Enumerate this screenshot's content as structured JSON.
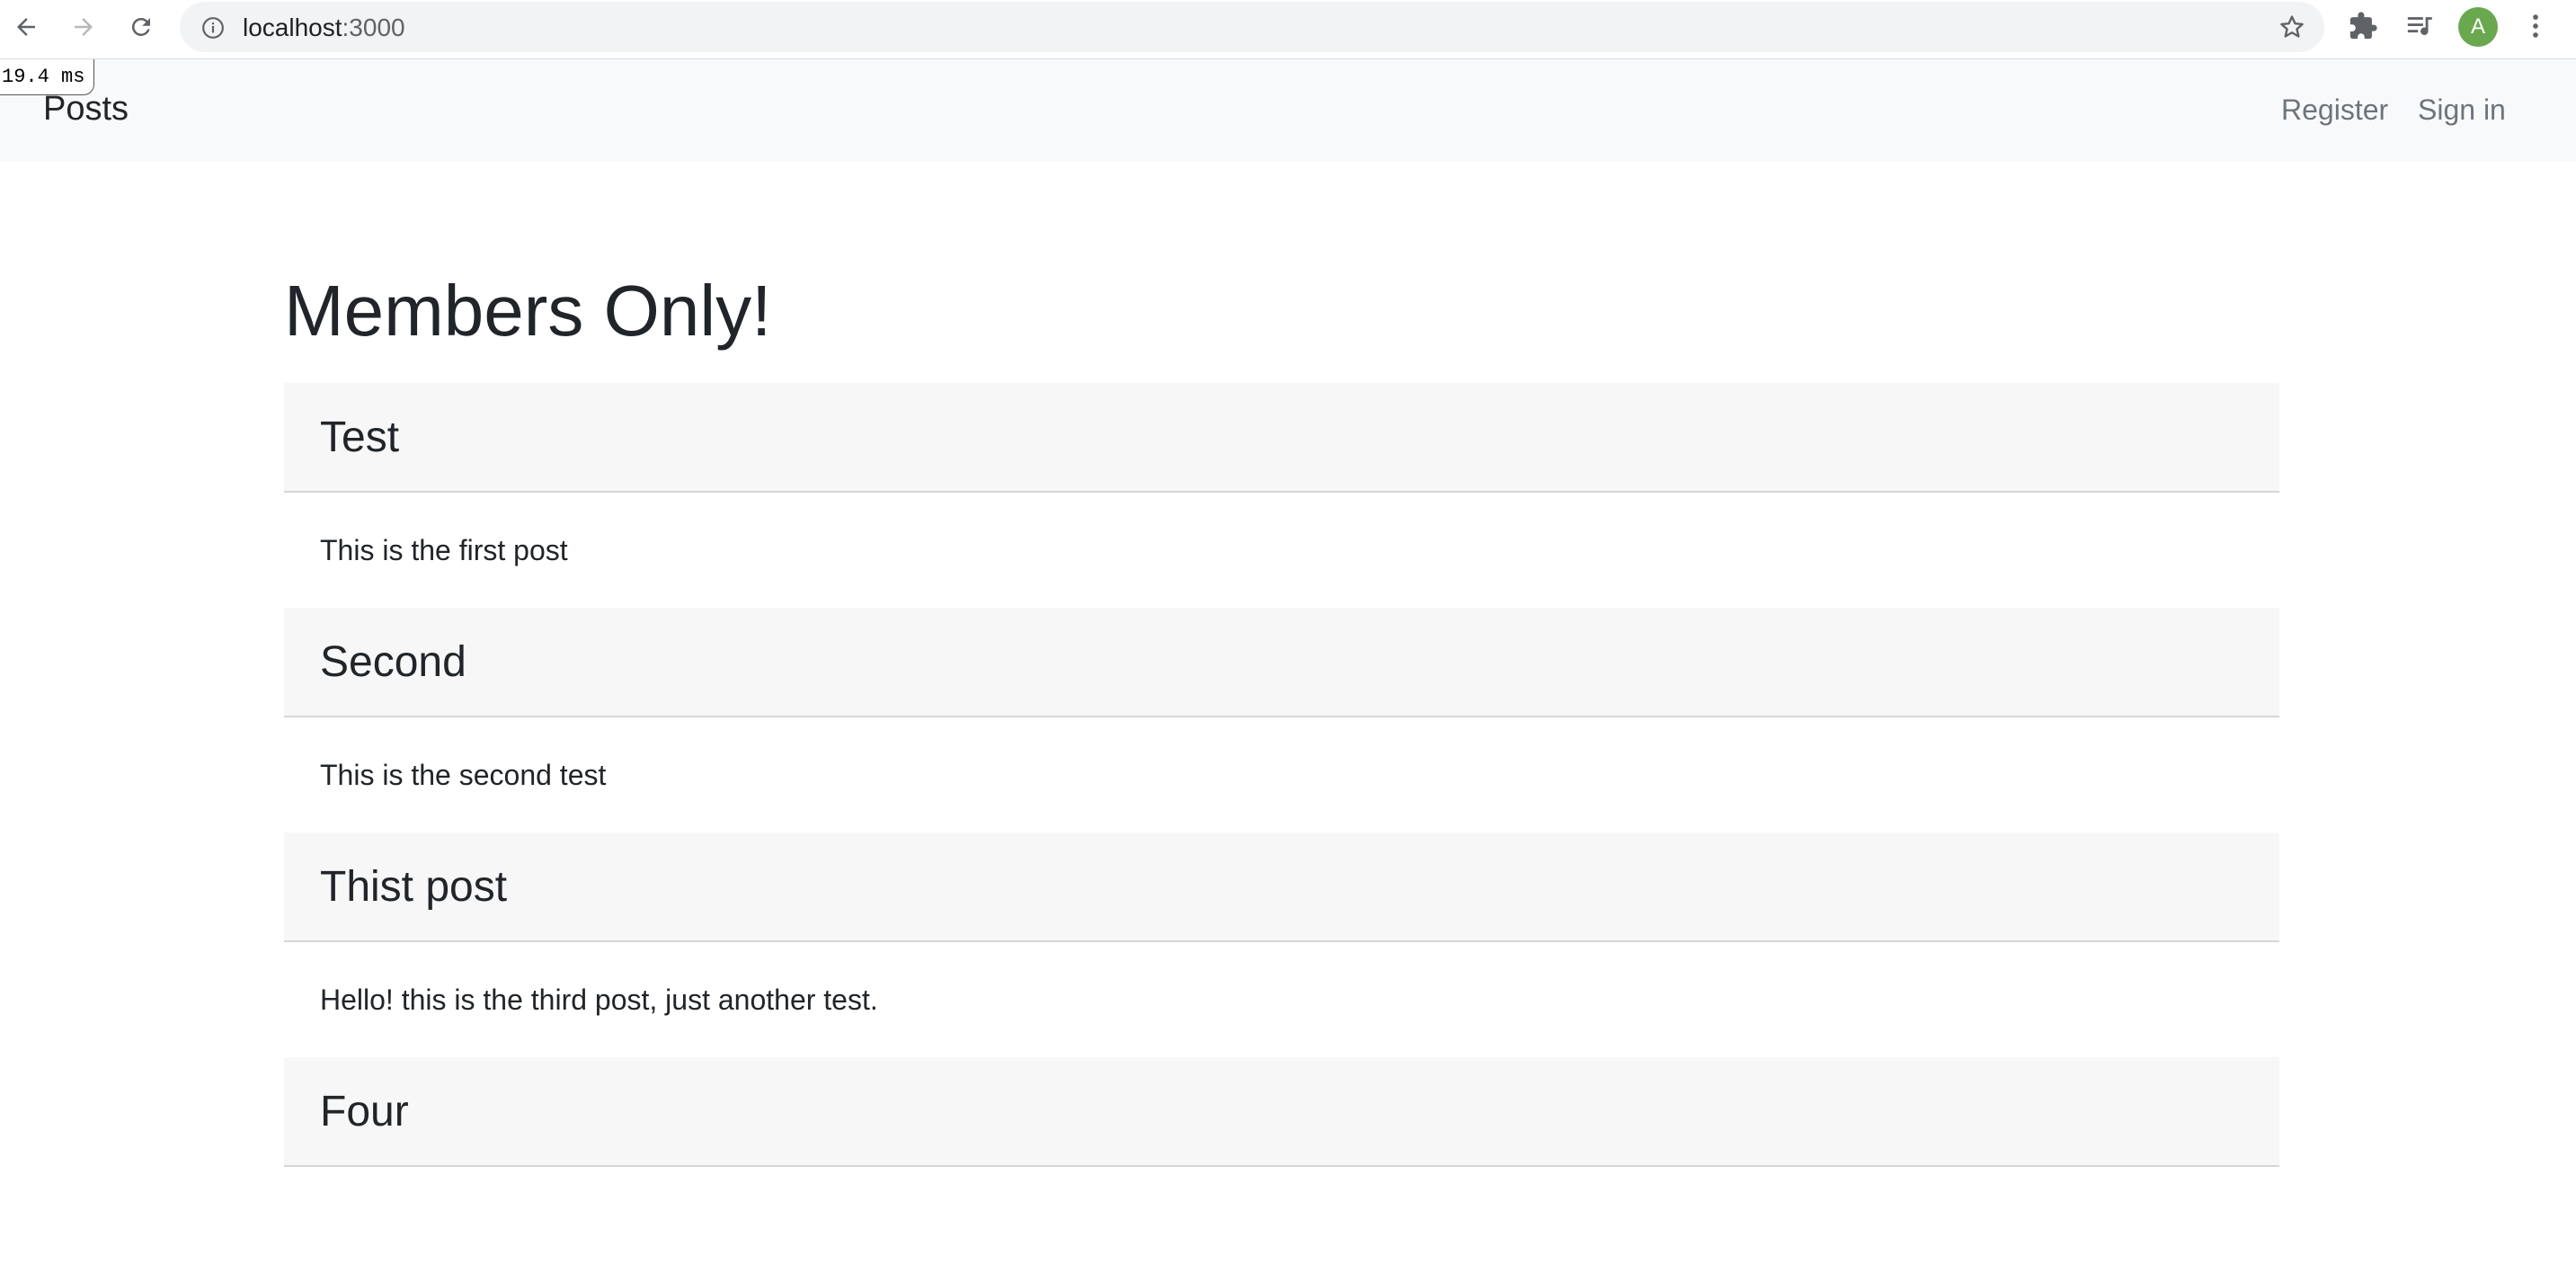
{
  "browser": {
    "url_host": "localhost",
    "url_port": ":3000",
    "profile_initial": "A",
    "icons": {
      "back": "back-arrow-icon",
      "forward": "forward-arrow-icon",
      "reload": "reload-icon",
      "site_info": "info-icon",
      "bookmark": "star-icon",
      "extensions": "puzzle-icon",
      "media": "playlist-icon",
      "menu": "kebab-menu-icon"
    },
    "avatar_color": "#6aa84f"
  },
  "timing_badge": "19.4 ms",
  "navbar": {
    "brand": "Posts",
    "links": [
      "Register",
      "Sign in"
    ]
  },
  "main": {
    "title": "Members Only!",
    "posts": [
      {
        "title": "Test",
        "body": "This is the first post"
      },
      {
        "title": "Second",
        "body": "This is the second test"
      },
      {
        "title": "Thist post",
        "body": "Hello! this is the third post, just another test."
      },
      {
        "title": "Four",
        "body": ""
      }
    ]
  },
  "colors": {
    "navbar_bg": "#f8f9fa",
    "card_header_bg": "#f7f7f7",
    "text": "#212529",
    "muted_link": "#6c757d"
  }
}
